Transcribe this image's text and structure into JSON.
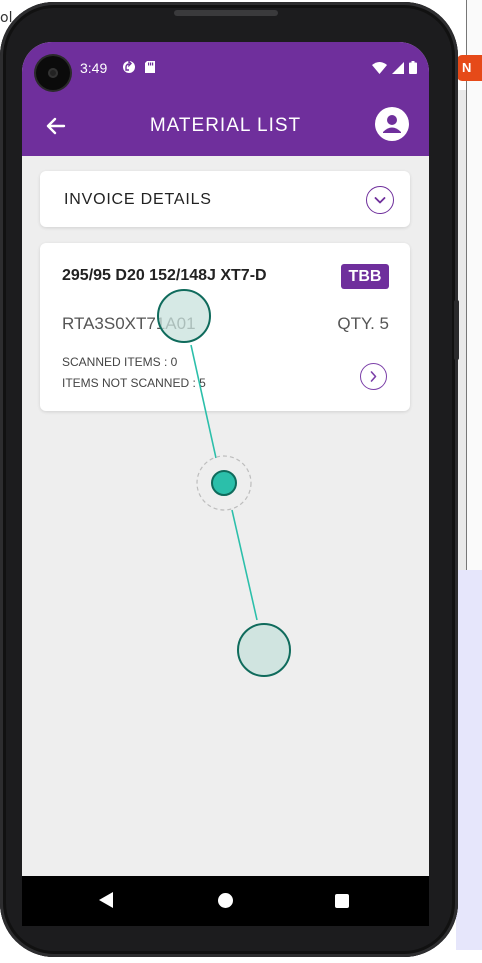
{
  "background": {
    "left_text": "ol",
    "right_badge": "N"
  },
  "status_bar": {
    "time": "3:49",
    "icons_left": [
      "sync-icon",
      "sd-card-icon"
    ],
    "icons_right": [
      "wifi-icon",
      "signal-icon",
      "battery-icon"
    ]
  },
  "app_bar": {
    "title": "MATERIAL LIST",
    "back_icon": "arrow-left-icon",
    "profile_icon": "account-circle-icon"
  },
  "invoice": {
    "title": "INVOICE DETAILS",
    "expand_icon": "chevron-down-icon"
  },
  "materials": [
    {
      "name": "295/95 D20 152/148J XT7-D",
      "badge": "TBB",
      "code": "RTA3S0XT71A01",
      "qty": "QTY. 5",
      "scanned": "SCANNED ITEMS : 0",
      "not_scanned": "ITEMS NOT SCANNED : 5",
      "open_icon": "chevron-right-icon"
    }
  ],
  "nav_bar": {
    "icons": [
      "back-triangle-icon",
      "home-circle-icon",
      "recents-square-icon"
    ]
  },
  "colors": {
    "primary": "#6f2f9c",
    "gesture": "#2bbfaa",
    "background": "#eeeeee"
  }
}
